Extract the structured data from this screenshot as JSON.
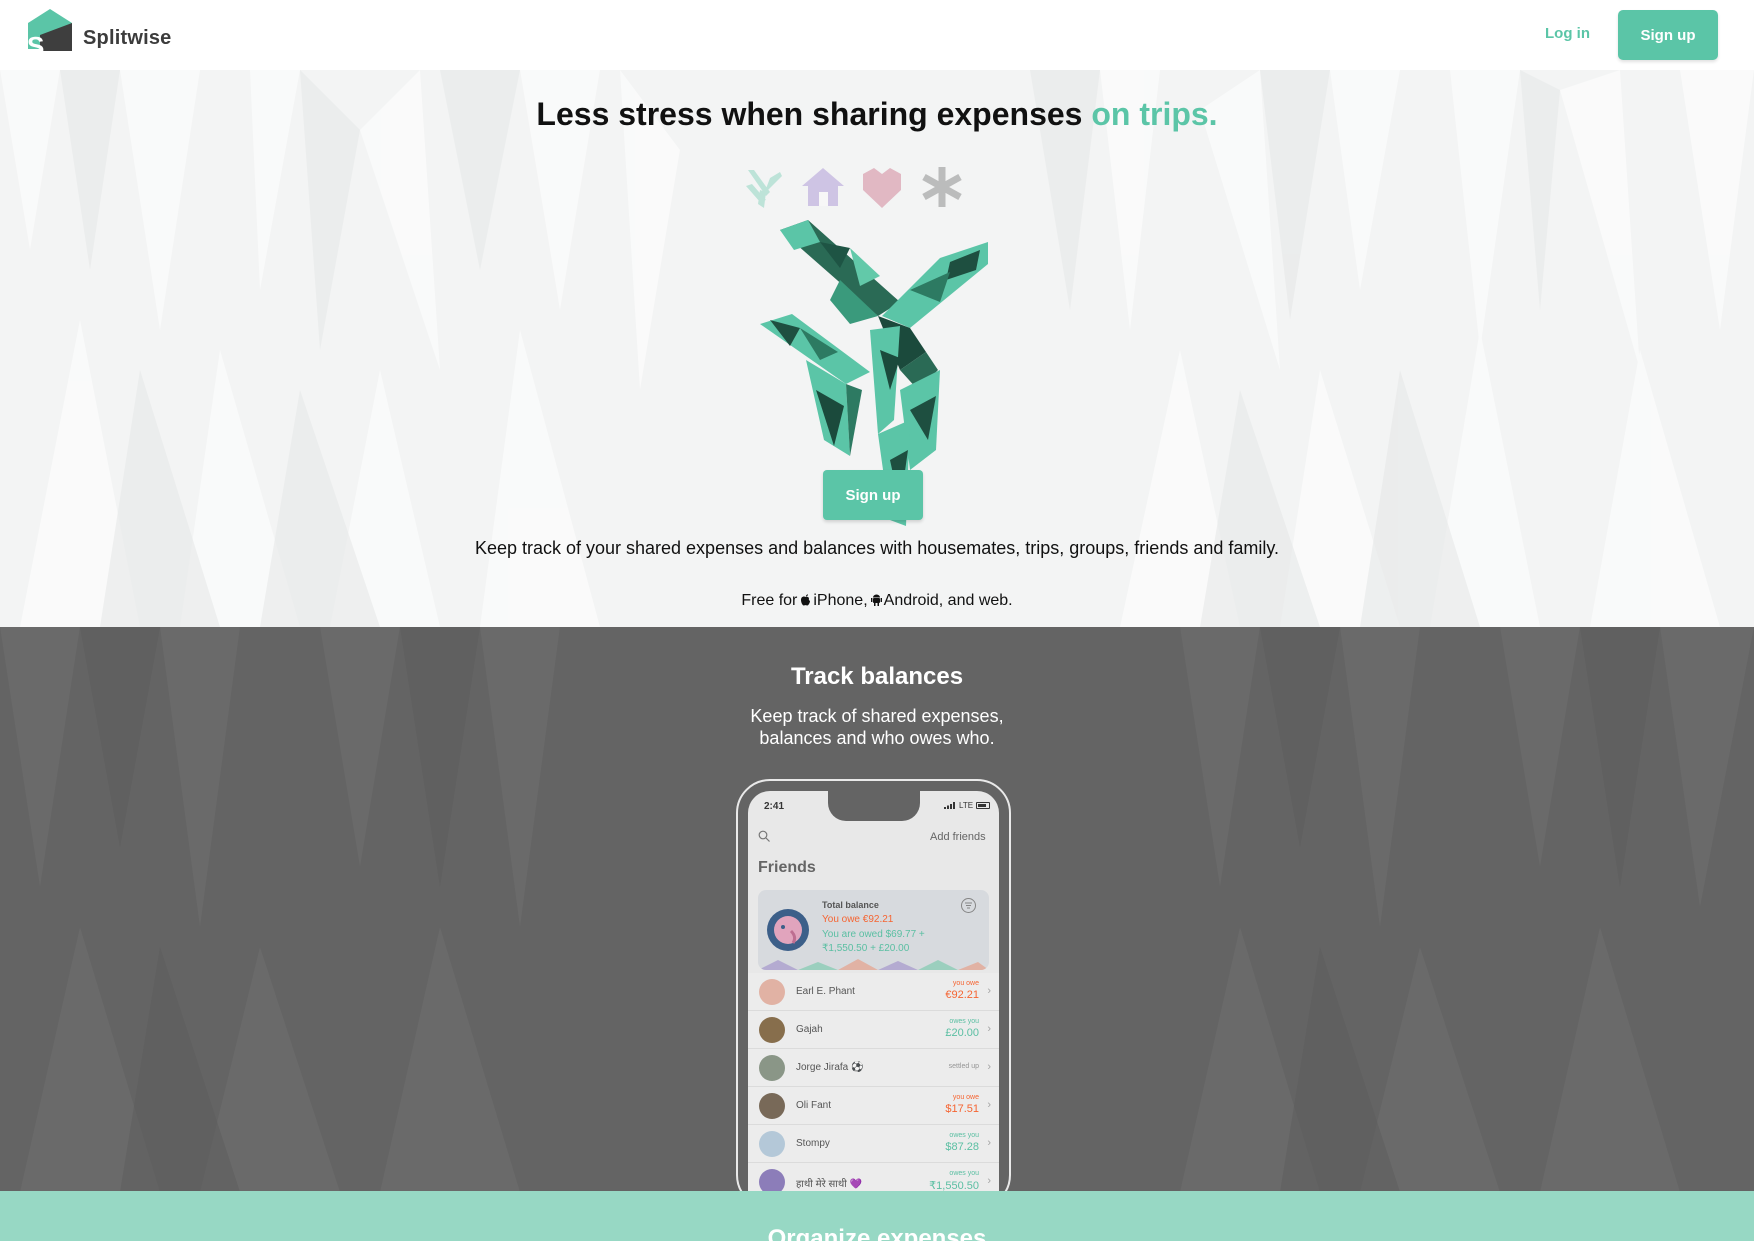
{
  "brand": {
    "name": "Splitwise",
    "accent": "#5bc5a7",
    "dark_band": "#646464",
    "mint_band": "#97d8c4"
  },
  "header": {
    "login_label": "Log in",
    "signup_label": "Sign up"
  },
  "hero": {
    "title_main": "Less stress when sharing expenses ",
    "title_accent": "on trips.",
    "category_icons": [
      "plane-icon",
      "house-icon",
      "heart-icon",
      "asterisk-icon"
    ],
    "signup_label": "Sign up",
    "description": "Keep track of your shared expenses and balances with housemates, trips, groups, friends and family.",
    "free_prefix": "Free for",
    "iphone": "iPhone,",
    "android": "Android,",
    "free_suffix": " and web."
  },
  "track": {
    "title": "Track balances",
    "subtitle_line1": "Keep track of shared expenses,",
    "subtitle_line2": "balances and who owes who."
  },
  "phone": {
    "time": "2:41",
    "network": "LTE",
    "add_friends": "Add friends",
    "friends_heading": "Friends",
    "total_balance_label": "Total balance",
    "you_owe": "You owe €92.21",
    "you_are_owed_line1": "You are owed $69.77 +",
    "you_are_owed_line2": "₹1,550.50 + £20.00",
    "friends": [
      {
        "name": "Earl E. Phant",
        "status": "you owe",
        "amount": "€92.21",
        "kind": "owe",
        "avatar_color": "#e9b7a8"
      },
      {
        "name": "Gajah",
        "status": "owes you",
        "amount": "£20.00",
        "kind": "owed",
        "avatar_color": "#8a6f4b"
      },
      {
        "name": "Jorge Jirafa ⚽",
        "status": "settled up",
        "amount": "",
        "kind": "settled",
        "avatar_color": "#8d9a8a"
      },
      {
        "name": "Oli Fant",
        "status": "you owe",
        "amount": "$17.51",
        "kind": "owe",
        "avatar_color": "#7a6a58"
      },
      {
        "name": "Stompy",
        "status": "owes you",
        "amount": "$87.28",
        "kind": "owed",
        "avatar_color": "#b9cfe0"
      },
      {
        "name": "हाथी मेरे साथी 💜",
        "status": "owes you",
        "amount": "₹1,550.50",
        "kind": "owed",
        "avatar_color": "#8f7fbf"
      }
    ]
  },
  "organize": {
    "title": "Organize expenses"
  }
}
